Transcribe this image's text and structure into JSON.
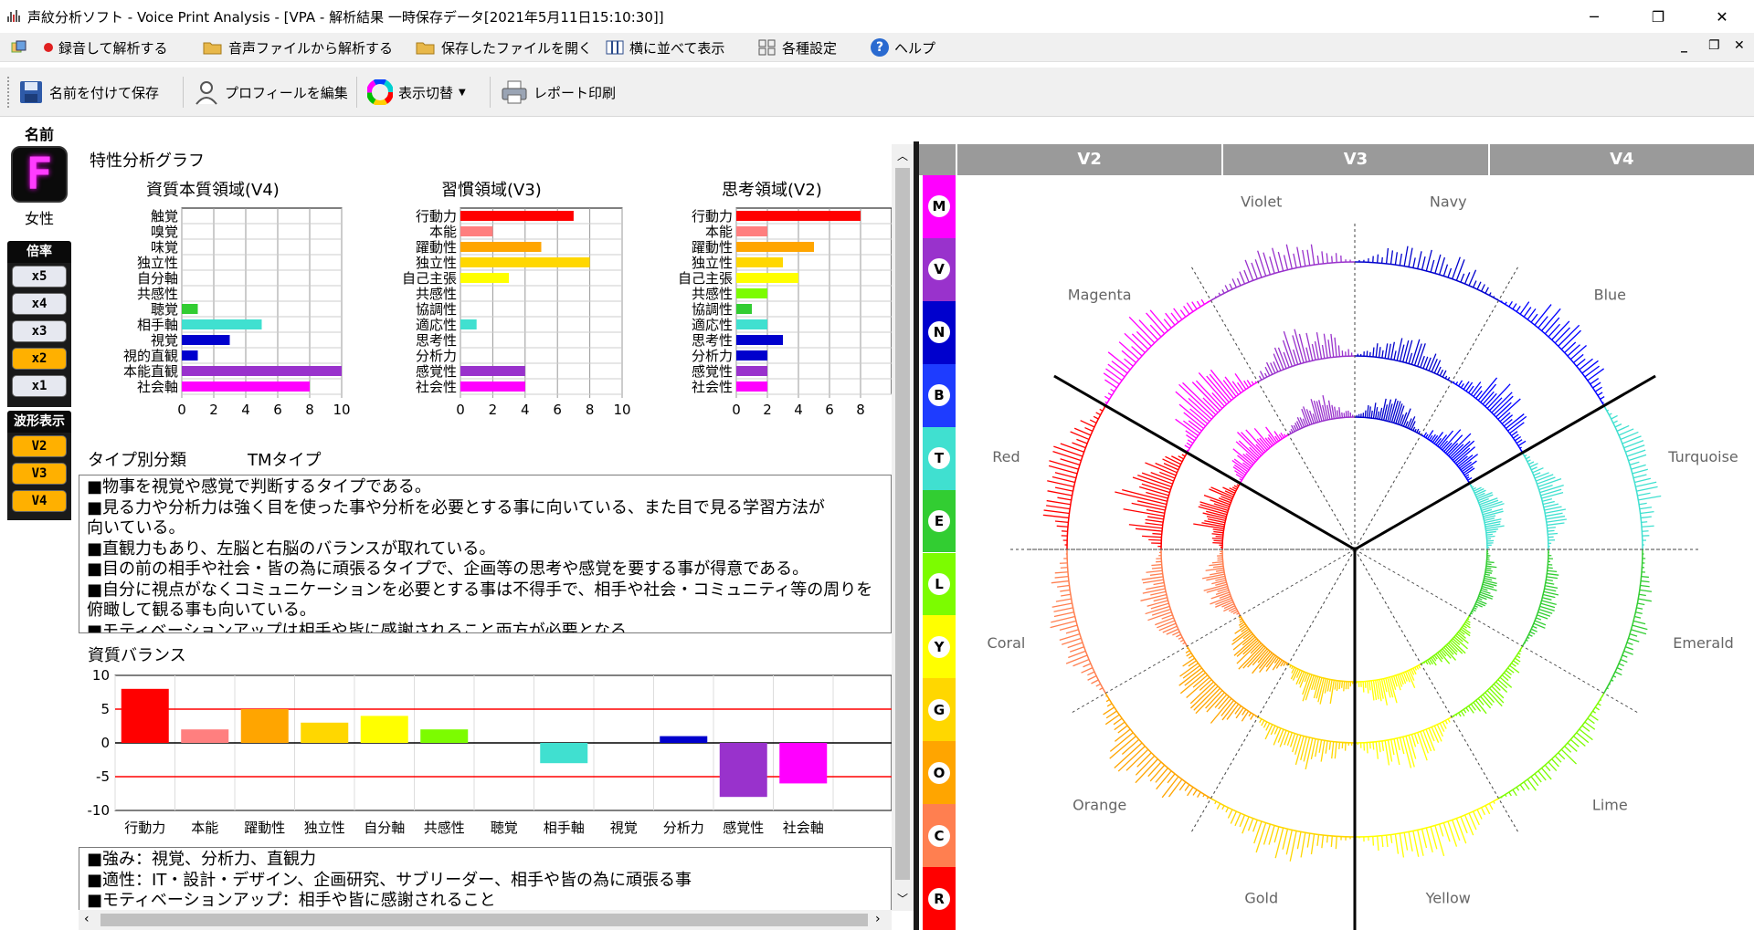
{
  "window": {
    "title": "声紋分析ソフト - Voice Print Analysis - [VPA - 解析結果 一時保存データ[2021年5月11日15:10:30]]",
    "minimize": "─",
    "restore": "❐",
    "close": "✕"
  },
  "menubar": {
    "items": [
      "録音して解析する",
      "音声ファイルから解析する",
      "保存したファイルを開く",
      "横に並べて表示",
      "各種設定",
      "ヘルプ"
    ]
  },
  "toolbar": {
    "items": [
      "名前を付けて保存",
      "プロフィールを編集",
      "表示切替",
      "レポート印刷"
    ]
  },
  "left": {
    "name_label": "名前",
    "avatar_letter": "F",
    "gender": "女性",
    "rate_header": "倍率",
    "rates": [
      "x5",
      "x4",
      "x3",
      "x2",
      "x1"
    ],
    "active_rate": "x2",
    "wave_header": "波形表示",
    "waves": [
      "V2",
      "V3",
      "V4"
    ]
  },
  "graph": {
    "title": "特性分析グラフ",
    "charts": [
      {
        "title": "資質本質領域(V4)",
        "labels": [
          "触覚",
          "嗅覚",
          "味覚",
          "独立性",
          "自分軸",
          "共感性",
          "聴覚",
          "相手軸",
          "視覚",
          "視的直観",
          "本能直観",
          "社会軸"
        ]
      },
      {
        "title": "習慣領域(V3)",
        "labels": [
          "行動力",
          "本能",
          "躍動性",
          "独立性",
          "自己主張",
          "共感性",
          "協調性",
          "適応性",
          "思考性",
          "分析力",
          "感覚性",
          "社会性"
        ]
      },
      {
        "title": "思考領域(V2)",
        "labels": [
          "行動力",
          "本能",
          "躍動性",
          "独立性",
          "自己主張",
          "共感性",
          "協調性",
          "適応性",
          "思考性",
          "分析力",
          "感覚性",
          "社会性"
        ]
      }
    ],
    "ticks_a": [
      "0",
      "2",
      "4",
      "6",
      "8",
      "10"
    ],
    "ticks_b": [
      "0",
      "2",
      "4",
      "6",
      "8"
    ]
  },
  "chart_data": [
    {
      "type": "bar",
      "title": "資質本質領域(V4)",
      "categories": [
        "触覚",
        "嗅覚",
        "味覚",
        "独立性",
        "自分軸",
        "共感性",
        "聴覚",
        "相手軸",
        "視覚",
        "視的直観",
        "本能直観",
        "社会軸"
      ],
      "values": [
        0,
        0,
        0,
        0,
        0,
        0,
        1,
        5,
        3,
        1,
        10,
        8
      ],
      "colors": [
        "#ff0000",
        "#ff7f7f",
        "#ffa500",
        "#ffd700",
        "#ffff00",
        "#7cfc00",
        "#32cd32",
        "#40e0d0",
        "#0000cd",
        "#0000cd",
        "#9932cc",
        "#ff00ff"
      ],
      "xlim": [
        0,
        10
      ]
    },
    {
      "type": "bar",
      "title": "習慣領域(V3)",
      "categories": [
        "行動力",
        "本能",
        "躍動性",
        "独立性",
        "自己主張",
        "共感性",
        "協調性",
        "適応性",
        "思考性",
        "分析力",
        "感覚性",
        "社会性"
      ],
      "values": [
        7,
        2,
        5,
        8,
        3,
        0,
        0,
        1,
        0,
        0,
        4,
        4
      ],
      "colors": [
        "#ff0000",
        "#ff7f7f",
        "#ffa500",
        "#ffd700",
        "#ffff00",
        "#7cfc00",
        "#32cd32",
        "#40e0d0",
        "#0000cd",
        "#0000cd",
        "#9932cc",
        "#ff00ff"
      ],
      "xlim": [
        0,
        10
      ]
    },
    {
      "type": "bar",
      "title": "思考領域(V2)",
      "categories": [
        "行動力",
        "本能",
        "躍動性",
        "独立性",
        "自己主張",
        "共感性",
        "協調性",
        "適応性",
        "思考性",
        "分析力",
        "感覚性",
        "社会性"
      ],
      "values": [
        8,
        2,
        5,
        3,
        4,
        2,
        1,
        2,
        3,
        2,
        2,
        2
      ],
      "colors": [
        "#ff0000",
        "#ff7f7f",
        "#ffa500",
        "#ffd700",
        "#ffff00",
        "#7cfc00",
        "#32cd32",
        "#40e0d0",
        "#0000cd",
        "#0000cd",
        "#9932cc",
        "#ff00ff"
      ],
      "xlim": [
        0,
        8
      ]
    },
    {
      "type": "bar",
      "title": "資質バランス",
      "categories": [
        "行動力",
        "本能",
        "躍動性",
        "独立性",
        "自分軸",
        "共感性",
        "聴覚",
        "相手軸",
        "視覚",
        "分析力",
        "感覚性",
        "社会軸"
      ],
      "values": [
        8,
        2,
        5,
        3,
        4,
        2,
        0,
        -3,
        0,
        1,
        -8,
        -6
      ],
      "colors": [
        "#ff0000",
        "#ff7f7f",
        "#ffa500",
        "#ffd700",
        "#ffff00",
        "#7cfc00",
        "#32cd32",
        "#40e0d0",
        "#0000cd",
        "#0000cd",
        "#9932cc",
        "#ff00ff"
      ],
      "ylim": [
        -10,
        10
      ],
      "yticks": [
        "10",
        "5",
        "0",
        "-5",
        "-10"
      ],
      "reference_lines": [
        5,
        -5
      ]
    }
  ],
  "type_section": {
    "title": "タイプ別分類",
    "type_name": "TMタイプ",
    "lines": [
      "■物事を視覚や感覚で判断するタイプである。",
      "■見る力や分析力は強く目を使った事や分析を必要とする事に向いている、また目で見る学習方法が",
      "向いている。",
      "■直観力もあり、左脳と右脳のバランスが取れている。",
      "■目の前の相手や社会・皆の為に頑張るタイプで、企画等の思考や感覚を要する事が得意である。",
      "■自分に視点がなくコミュニケーションを必要とする事は不得手で、相手や社会・コミュニティ等の周りを",
      "俯瞰して観る事も向いている。",
      "■モティベーションアップは相手や皆に感謝されること両方が必要となる"
    ]
  },
  "balance": {
    "title": "資質バランス"
  },
  "strengths": {
    "lines": [
      "■強み：視覚、分析力、直観力",
      "■適性：IT・設計・デザイン、企画研究、サブリーダー、相手や皆の為に頑張る事",
      "■モティベーションアップ：相手や皆に感謝されること"
    ]
  },
  "radar": {
    "headers": [
      "V2",
      "V3",
      "V4"
    ],
    "strip": [
      {
        "letter": "M",
        "color": "#ff00ff"
      },
      {
        "letter": "V",
        "color": "#9932cc"
      },
      {
        "letter": "N",
        "color": "#0000cd"
      },
      {
        "letter": "B",
        "color": "#1e3cff"
      },
      {
        "letter": "T",
        "color": "#40e0d0"
      },
      {
        "letter": "E",
        "color": "#32cd32"
      },
      {
        "letter": "L",
        "color": "#7cfc00"
      },
      {
        "letter": "Y",
        "color": "#ffff00"
      },
      {
        "letter": "G",
        "color": "#ffd700"
      },
      {
        "letter": "O",
        "color": "#ffa500"
      },
      {
        "letter": "C",
        "color": "#ff7f50"
      },
      {
        "letter": "R",
        "color": "#ff0000"
      }
    ],
    "sectors": [
      {
        "name": "Navy",
        "color": "#0000cd",
        "amp": 0.55
      },
      {
        "name": "Blue",
        "color": "#0000ff",
        "amp": 0.7
      },
      {
        "name": "Turquoise",
        "color": "#40e0d0",
        "amp": 0.55
      },
      {
        "name": "Emerald",
        "color": "#32cd32",
        "amp": 0.35
      },
      {
        "name": "Lime",
        "color": "#7cfc00",
        "amp": 0.45
      },
      {
        "name": "Yellow",
        "color": "#ffff00",
        "amp": 0.65
      },
      {
        "name": "Gold",
        "color": "#ffd700",
        "amp": 0.7
      },
      {
        "name": "Orange",
        "color": "#ffa500",
        "amp": 0.8
      },
      {
        "name": "Coral",
        "color": "#ff7f50",
        "amp": 0.6
      },
      {
        "name": "Red",
        "color": "#ff0000",
        "amp": 0.85
      },
      {
        "name": "Magenta",
        "color": "#ff00ff",
        "amp": 0.75
      },
      {
        "name": "Violet",
        "color": "#9932cc",
        "amp": 0.6
      }
    ]
  },
  "colors": {
    "rate_normal": "#e6e8f0",
    "rate_active": "#ffb000",
    "wave_active": "#ffb000",
    "accent_avatar": "#ff00ff"
  }
}
